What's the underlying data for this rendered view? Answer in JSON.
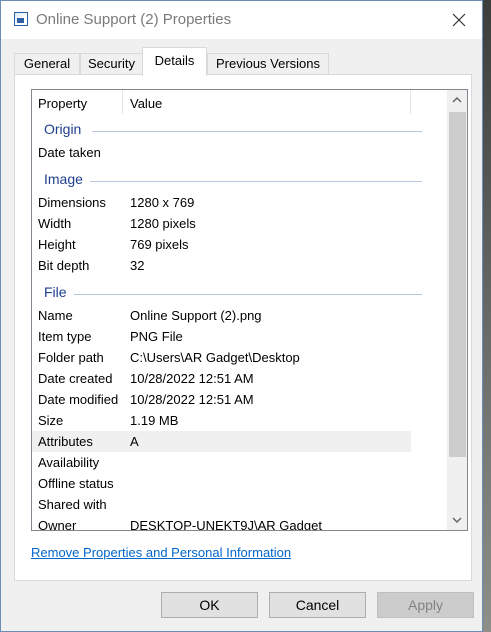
{
  "window": {
    "title": "Online Support (2) Properties"
  },
  "tabs": [
    {
      "label": "General"
    },
    {
      "label": "Security"
    },
    {
      "label": "Details"
    },
    {
      "label": "Previous Versions"
    }
  ],
  "active_tab": "Details",
  "columns": {
    "property": "Property",
    "value": "Value"
  },
  "groups": {
    "origin": {
      "label": "Origin",
      "rows": [
        {
          "key": "Date taken",
          "value": ""
        }
      ]
    },
    "image": {
      "label": "Image",
      "rows": [
        {
          "key": "Dimensions",
          "value": "1280 x 769"
        },
        {
          "key": "Width",
          "value": "1280 pixels"
        },
        {
          "key": "Height",
          "value": "769 pixels"
        },
        {
          "key": "Bit depth",
          "value": "32"
        }
      ]
    },
    "file": {
      "label": "File",
      "rows": [
        {
          "key": "Name",
          "value": "Online Support (2).png"
        },
        {
          "key": "Item type",
          "value": "PNG File"
        },
        {
          "key": "Folder path",
          "value": "C:\\Users\\AR Gadget\\Desktop"
        },
        {
          "key": "Date created",
          "value": "10/28/2022 12:51 AM"
        },
        {
          "key": "Date modified",
          "value": "10/28/2022 12:51 AM"
        },
        {
          "key": "Size",
          "value": "1.19 MB"
        },
        {
          "key": "Attributes",
          "value": "A"
        },
        {
          "key": "Availability",
          "value": ""
        },
        {
          "key": "Offline status",
          "value": ""
        },
        {
          "key": "Shared with",
          "value": ""
        },
        {
          "key": "Owner",
          "value": "DESKTOP-UNEKT9J\\AR Gadget"
        }
      ]
    }
  },
  "selected_row": "Attributes",
  "remove_link": "Remove Properties and Personal Information",
  "buttons": {
    "ok": "OK",
    "cancel": "Cancel",
    "apply": "Apply"
  },
  "colors": {
    "group_label": "#1e3f8c",
    "link": "#0066cc",
    "selected_row_bg": "#f0f0f0"
  },
  "icons": [
    "image-file-icon",
    "close-icon",
    "scroll-up-arrow-icon",
    "scroll-down-arrow-icon"
  ]
}
